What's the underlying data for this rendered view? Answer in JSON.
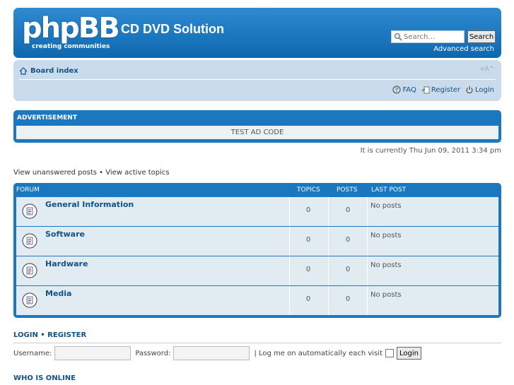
{
  "header": {
    "logo_text": "phpBB",
    "logo_tagline": "creating    communities",
    "site_title": "CD DVD Solution",
    "search_placeholder": "Search…",
    "search_button": "Search",
    "advanced_search": "Advanced search"
  },
  "navbar": {
    "board_index": "Board index",
    "font_resize": "∨A^",
    "faq": "FAQ",
    "register": "Register",
    "login": "Login"
  },
  "ad": {
    "header": "ADVERTISEMENT",
    "content": "TEST AD CODE"
  },
  "current_time": "It is currently Thu Jun 09, 2011 3:34 pm",
  "quick_links": "View unanswered posts • View active topics",
  "forum_table": {
    "headers": {
      "forum": "FORUM",
      "topics": "TOPICS",
      "posts": "POSTS",
      "last_post": "LAST POST"
    },
    "rows": [
      {
        "title": "General Information",
        "topics": "0",
        "posts": "0",
        "last_post": "No posts"
      },
      {
        "title": "Software",
        "topics": "0",
        "posts": "0",
        "last_post": "No posts"
      },
      {
        "title": "Hardware",
        "topics": "0",
        "posts": "0",
        "last_post": "No posts"
      },
      {
        "title": "Media",
        "topics": "0",
        "posts": "0",
        "last_post": "No posts"
      }
    ]
  },
  "login_section": {
    "heading": "LOGIN  •  REGISTER",
    "username_label": "Username:",
    "password_label": "Password:",
    "remember_label": "| Log me on automatically each visit",
    "login_button": "Login"
  },
  "who_is_online": "WHO IS ONLINE",
  "colors": {
    "header_blue": "#1b77be",
    "navbar_bg": "#cadceb",
    "row_bg": "#e1ebf2",
    "link": "#105289"
  }
}
